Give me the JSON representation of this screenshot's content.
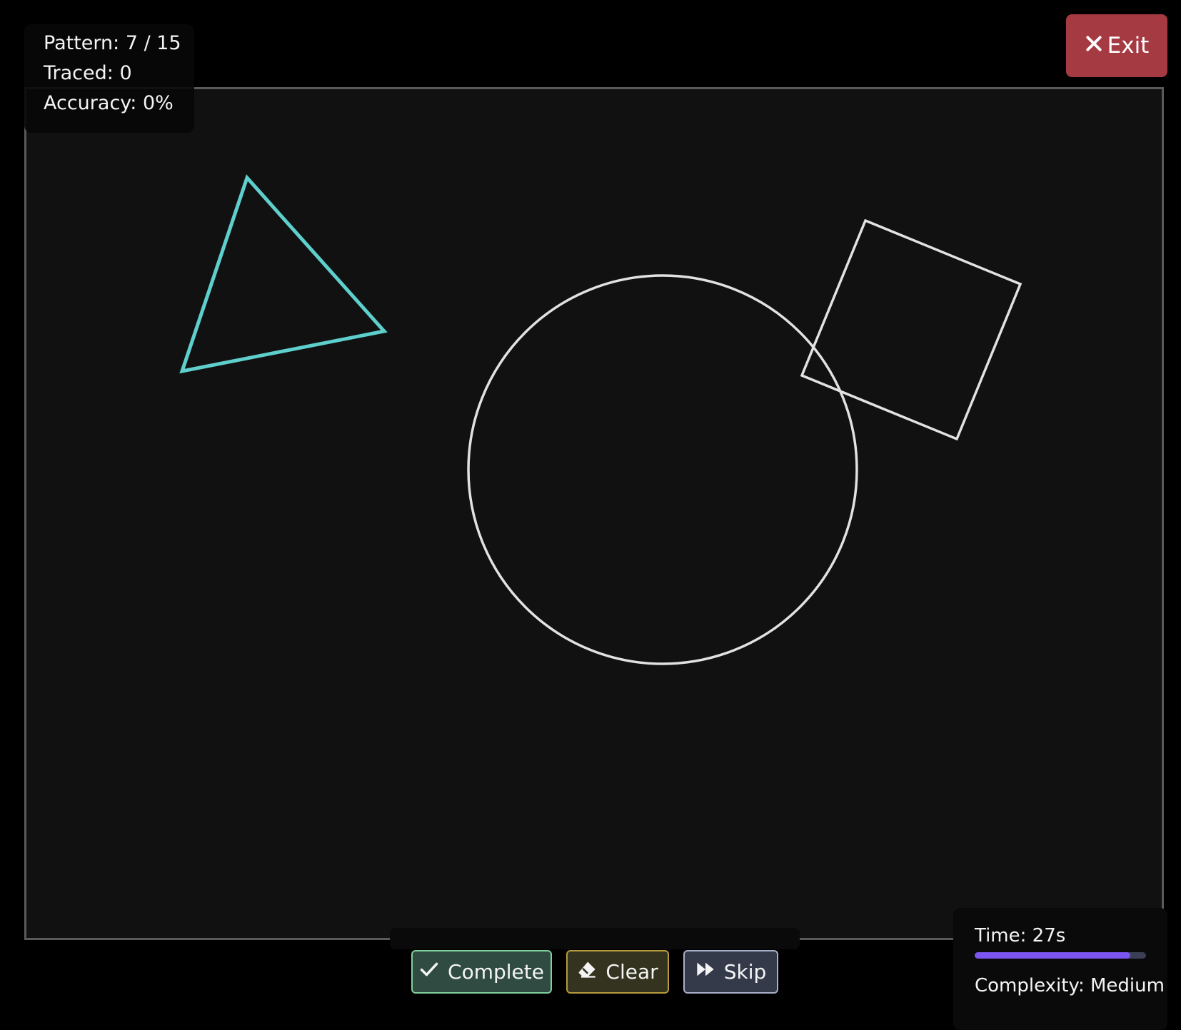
{
  "stats": {
    "pattern": "Pattern: 7 / 15",
    "traced": "Traced: 0",
    "accuracy": "Accuracy: 0%"
  },
  "exit": {
    "label": "Exit",
    "icon": "close-icon"
  },
  "actions": {
    "complete_label": "Complete",
    "complete_icon": "checkmark-icon",
    "clear_label": "Clear",
    "clear_icon": "eraser-icon",
    "skip_label": "Skip",
    "skip_icon": "fast-forward-icon"
  },
  "timer": {
    "label": "Time: 27s",
    "progress_fraction": 0.91
  },
  "complexity": {
    "label": "Complexity: Medium"
  },
  "shapes": {
    "highlight_color": "#5ecfcc",
    "outline_color": "#e2e2e2"
  }
}
